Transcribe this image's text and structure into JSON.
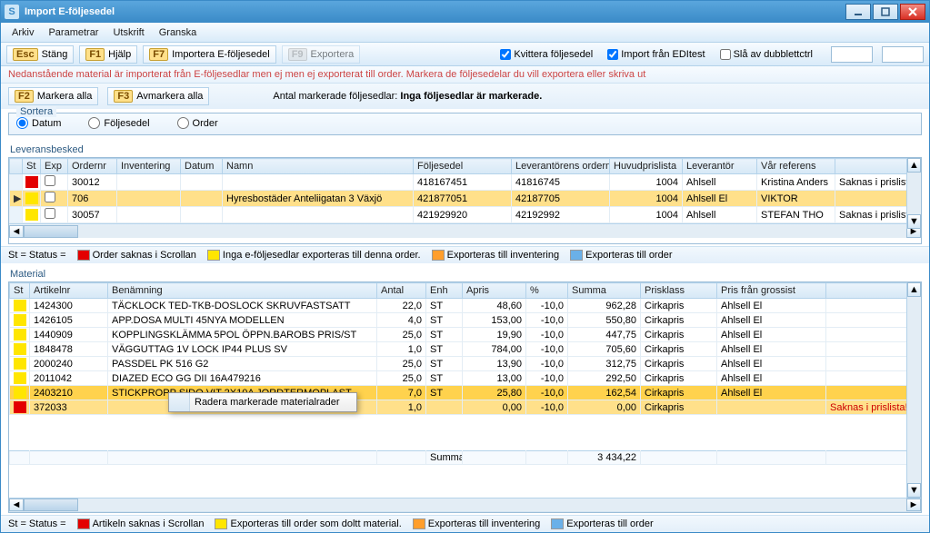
{
  "window": {
    "title": "Import E-följesedel"
  },
  "menu": {
    "items": [
      "Arkiv",
      "Parametrar",
      "Utskrift",
      "Granska"
    ]
  },
  "toolbar": {
    "esc_key": "Esc",
    "esc_label": "Stäng",
    "f1_key": "F1",
    "f1_label": "Hjälp",
    "f7_key": "F7",
    "f7_label": "Importera E-följesedel",
    "f9_key": "F9",
    "f9_label": "Exportera",
    "chk_kvittera": "Kvittera följesedel",
    "chk_import": "Import från EDItest",
    "chk_dubblett": "Slå av dubblettctrl"
  },
  "info_text": "Nedanstående material är importerat från E-följesedlar men ej  men ej exporterat till order. Markera de följesedelar du vill exportera eller skriva ut",
  "second": {
    "f2_key": "F2",
    "f2_label": "Markera alla",
    "f3_key": "F3",
    "f3_label": "Avmarkera alla",
    "msg_prefix": "Antal markerade följesedlar: ",
    "msg_bold": "Inga följesedlar är markerade."
  },
  "sort": {
    "legend": "Sortera",
    "options": [
      "Datum",
      "Följesedel",
      "Order"
    ],
    "selected": 0
  },
  "lev": {
    "legend": "Leveransbesked",
    "headers": [
      "St",
      "Exp",
      "Ordernr",
      "Inventering",
      "Datum",
      "Namn",
      "Följesedel",
      "Leverantörens ordernr",
      "Huvudprislista",
      "Leverantör",
      "Vår referens",
      ""
    ],
    "rows": [
      {
        "st": "red",
        "exp": false,
        "order": "30012",
        "inv": "",
        "datum": "",
        "namn": "",
        "folj": "418167451",
        "levorder": "41816745",
        "prislista": "1004",
        "lev": "Ahlsell",
        "ref": "Kristina Anders",
        "extra": "Saknas i prislista"
      },
      {
        "st": "yellow",
        "exp": false,
        "order": "706",
        "inv": "",
        "datum": "",
        "namn": "Hyresbostäder Anteliigatan 3 Växjö",
        "folj": "421877051",
        "levorder": "42187705",
        "prislista": "1004",
        "lev": "Ahlsell El",
        "ref": "VIKTOR",
        "extra": "",
        "sel": true
      },
      {
        "st": "yellow",
        "exp": false,
        "order": "30057",
        "inv": "",
        "datum": "",
        "namn": "",
        "folj": "421929920",
        "levorder": "42192992",
        "prislista": "1004",
        "lev": "Ahlsell",
        "ref": "STEFAN THO",
        "extra": "Saknas i prislista"
      }
    ],
    "statusbar": {
      "st": "St = Status =",
      "items": [
        "Order saknas i Scrollan",
        "Inga e-följesedlar exporteras till denna order.",
        "Exporteras till inventering",
        "Exporteras till order"
      ]
    }
  },
  "mat": {
    "legend": "Material",
    "headers": [
      "St",
      "Artikelnr",
      "Benämning",
      "Antal",
      "Enh",
      "Apris",
      "%",
      "Summa",
      "Prisklass",
      "Pris från grossist",
      ""
    ],
    "rows": [
      {
        "st": "yellow",
        "art": "1424300",
        "ben": "TÄCKLOCK TED-TKB-DOSLOCK SKRUVFASTSATT",
        "antal": "22,0",
        "enh": "ST",
        "apris": "48,60",
        "pct": "-10,0",
        "summa": "962,28",
        "klass": "Cirkapris",
        "gross": "Ahlsell El",
        "extra": ""
      },
      {
        "st": "yellow",
        "art": "1426105",
        "ben": "APP.DOSA MULTI 45NYA MODELLEN",
        "antal": "4,0",
        "enh": "ST",
        "apris": "153,00",
        "pct": "-10,0",
        "summa": "550,80",
        "klass": "Cirkapris",
        "gross": "Ahlsell El",
        "extra": ""
      },
      {
        "st": "yellow",
        "art": "1440909",
        "ben": "KOPPLINGSKLÄMMA 5POL ÖPPN.BAROBS PRIS/ST",
        "antal": "25,0",
        "enh": "ST",
        "apris": "19,90",
        "pct": "-10,0",
        "summa": "447,75",
        "klass": "Cirkapris",
        "gross": "Ahlsell El",
        "extra": ""
      },
      {
        "st": "yellow",
        "art": "1848478",
        "ben": "VÄGGUTTAG 1V LOCK IP44 PLUS SV",
        "antal": "1,0",
        "enh": "ST",
        "apris": "784,00",
        "pct": "-10,0",
        "summa": "705,60",
        "klass": "Cirkapris",
        "gross": "Ahlsell El",
        "extra": ""
      },
      {
        "st": "yellow",
        "art": "2000240",
        "ben": "PASSDEL PK 516 G2",
        "antal": "25,0",
        "enh": "ST",
        "apris": "13,90",
        "pct": "-10,0",
        "summa": "312,75",
        "klass": "Cirkapris",
        "gross": "Ahlsell El",
        "extra": ""
      },
      {
        "st": "yellow",
        "art": "2011042",
        "ben": "DIAZED ECO GG DII 16A479216",
        "antal": "25,0",
        "enh": "ST",
        "apris": "13,00",
        "pct": "-10,0",
        "summa": "292,50",
        "klass": "Cirkapris",
        "gross": "Ahlsell El",
        "extra": ""
      },
      {
        "st": "yellow",
        "art": "2403210",
        "ben": "STICKPROPP SIDO VIT 2X10A JORDTERMOPLAST",
        "antal": "7,0",
        "enh": "ST",
        "apris": "25,80",
        "pct": "-10,0",
        "summa": "162,54",
        "klass": "Cirkapris",
        "gross": "Ahlsell El",
        "extra": "",
        "sel": true
      },
      {
        "st": "red",
        "art": "372033",
        "ben": "",
        "antal": "1,0",
        "enh": "",
        "apris": "0,00",
        "pct": "-10,0",
        "summa": "0,00",
        "klass": "Cirkapris",
        "gross": "",
        "extra": "Saknas i prislista!",
        "bad": true
      }
    ],
    "sum_label": "Summa:",
    "sum_value": "3 434,22",
    "statusbar": {
      "st": "St = Status =",
      "items": [
        "Artikeln saknas i Scrollan",
        "Exporteras till order som doltt material.",
        "Exporteras till inventering",
        "Exporteras till order"
      ]
    }
  },
  "context_menu": {
    "item": "Radera markerade materialrader"
  }
}
